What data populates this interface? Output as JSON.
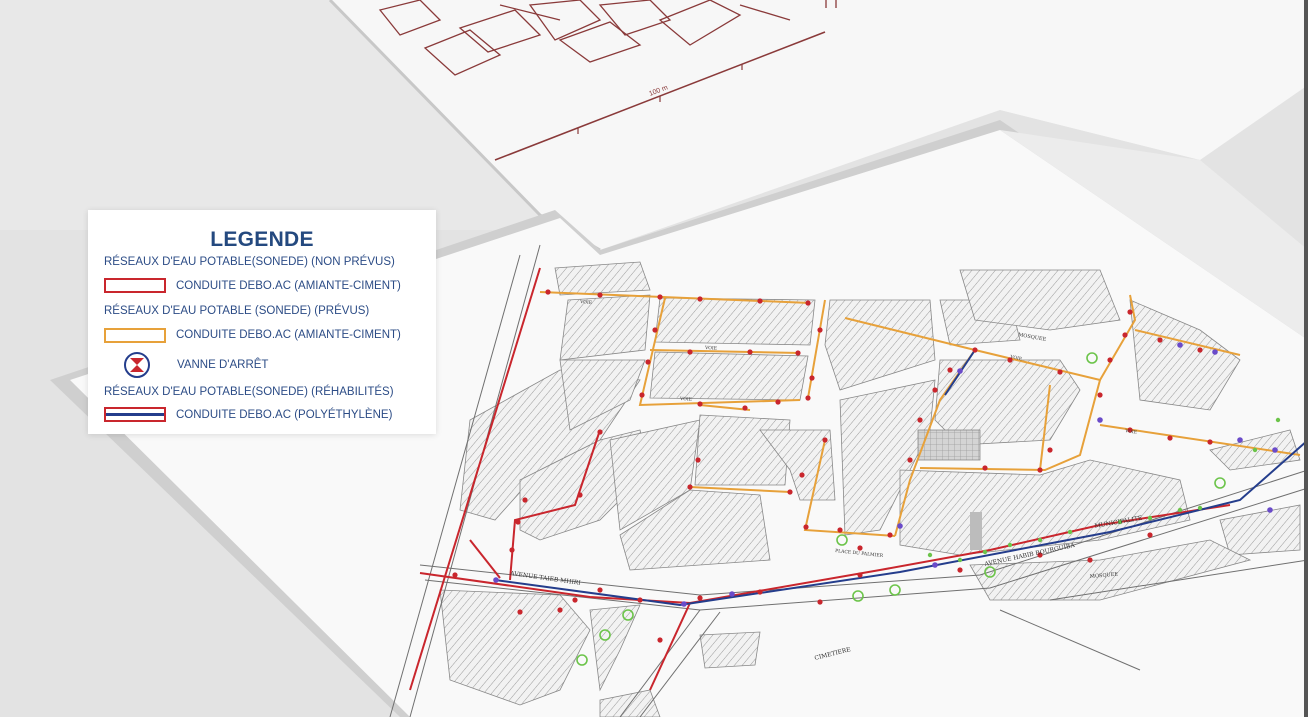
{
  "legend": {
    "title": "LEGENDE",
    "sections": [
      {
        "heading": "RÉSEAUX D'EAU POTABLE(SONEDE) (NON PRÉVUS)"
      },
      {
        "heading": "RÉSEAUX D'EAU POTABLE (SONEDE) (PRÉVUS)"
      },
      {
        "heading": "RÉSEAUX D'EAU POTABLE(SONEDE) (RÉHABILITÉS)"
      }
    ],
    "items": [
      {
        "label": "CONDUITE DEBO.AC (AMIANTE-CIMENT)",
        "icon": "red-double-line"
      },
      {
        "label": "CONDUITE DEBO.AC (AMIANTE-CIMENT)",
        "icon": "orange-double-line"
      },
      {
        "label": "VANNE D'ARRÊT",
        "icon": "shutoff-valve-icon"
      },
      {
        "label": "CONDUITE DEBO.AC (POLYÉTHYLÈNE)",
        "icon": "blue-red-double-line"
      }
    ]
  },
  "map_labels": {
    "avenue_taieb": "AVENUE TAIEB MHIRI",
    "avenue_habib": "AVENUE HABIB BOURGUIBA",
    "municipalite": "MUNICIPALITE",
    "mosquee": "MOSQUEE",
    "cimetiere": "CIMETIERE",
    "place": "PLACE DU PALMIER",
    "scale": "100 m",
    "voie": "VOIE"
  },
  "colors": {
    "non_prevus": "#c9262d",
    "prevus": "#e7a13a",
    "rehabilites": "#243d8c",
    "legend_text": "#2c4c86",
    "green_marker": "#6cc44a",
    "purple_marker": "#6a4bc9"
  }
}
